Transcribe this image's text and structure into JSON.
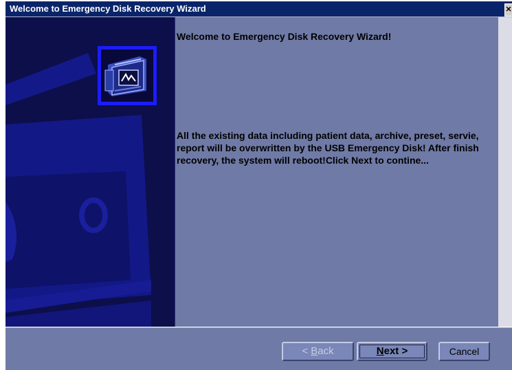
{
  "window": {
    "title": "Welcome to Emergency Disk Recovery Wizard",
    "close_glyph": "✕"
  },
  "side_panel": {
    "icon": "disk-drive-icon"
  },
  "content": {
    "heading": "Welcome to Emergency Disk Recovery Wizard!",
    "message": "All the existing data including patient data, archive, preset, servie, report will be overwritten by the USB Emergency Disk! After finish recovery, the system will reboot!Click Next to contine..."
  },
  "buttons": {
    "back": {
      "prefix": "< ",
      "mnemonic": "B",
      "rest": "ack",
      "enabled": false
    },
    "next": {
      "mnemonic": "N",
      "rest": "ext >",
      "enabled": true,
      "default": true
    },
    "cancel": {
      "label": "Cancel",
      "enabled": true
    }
  },
  "colors": {
    "title_bar": "#0a246a",
    "side_panel": "#0c0f4a",
    "content_bg": "#6f7aa6",
    "icon_border": "#1c1cff"
  }
}
